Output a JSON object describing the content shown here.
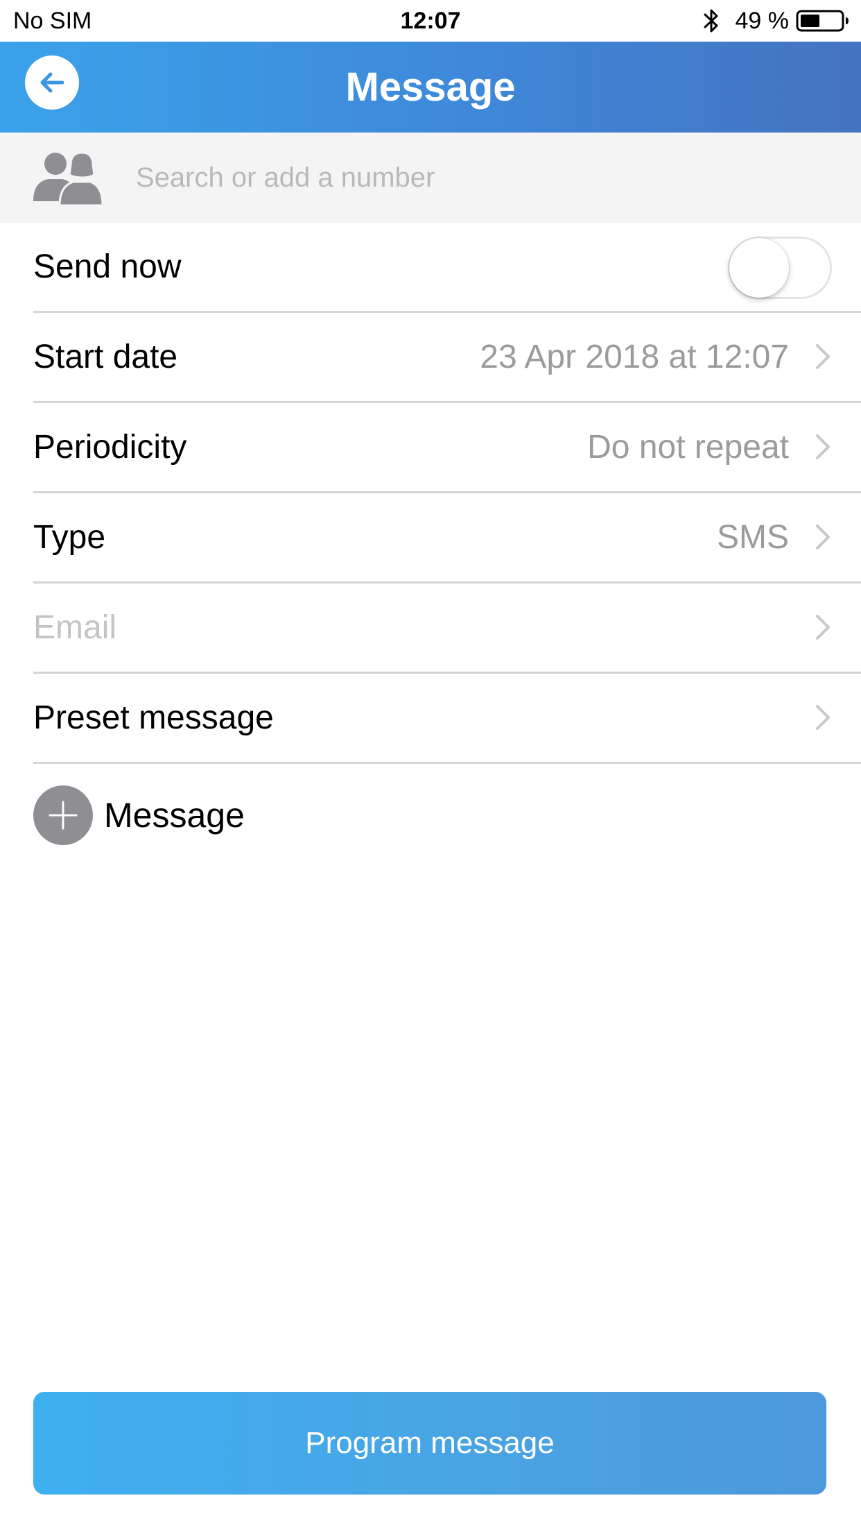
{
  "status_bar": {
    "carrier": "No SIM",
    "time": "12:07",
    "battery_percent": "49 %",
    "battery_level": 0.49,
    "icons": [
      "bluetooth-icon",
      "battery-icon"
    ]
  },
  "header": {
    "title": "Message",
    "back_icon": "arrow-left-icon",
    "gradient_colors": [
      "#3aa2ea",
      "#4473c0"
    ]
  },
  "search": {
    "placeholder": "Search or add a number",
    "value": "",
    "icon": "contacts-icon"
  },
  "rows": {
    "send_now": {
      "label": "Send now",
      "toggle_on": false
    },
    "start_date": {
      "label": "Start date",
      "value": "23 Apr 2018 at 12:07"
    },
    "periodicity": {
      "label": "Periodicity",
      "value": "Do not repeat"
    },
    "type": {
      "label": "Type",
      "value": "SMS"
    },
    "email": {
      "placeholder": "Email"
    },
    "preset_message": {
      "label": "Preset message"
    }
  },
  "add_message": {
    "label": "Message",
    "icon": "plus-icon"
  },
  "program_button": {
    "label": "Program message",
    "color": "#42a8ea"
  }
}
